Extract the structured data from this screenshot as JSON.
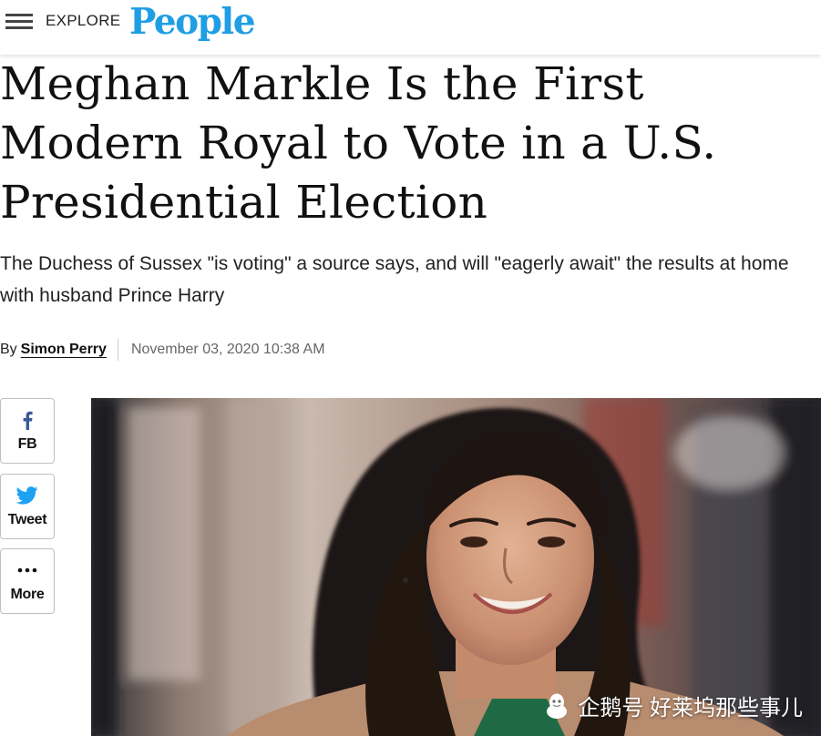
{
  "header": {
    "explore_label": "EXPLORE",
    "logo_text": "People"
  },
  "article": {
    "headline": "Meghan Markle Is the First Modern Royal to Vote in a U.S. Presidential Election",
    "dek": "The Duchess of Sussex \"is voting\" a source says, and will \"eagerly await\" the results at home with husband Prince Harry",
    "byline_prefix": "By",
    "author": "Simon Perry",
    "date": "November 03, 2020 10:38 AM"
  },
  "share": {
    "fb_label": "FB",
    "tweet_label": "Tweet",
    "more_label": "More"
  },
  "watermark": {
    "text": "企鹅号 好莱坞那些事儿"
  },
  "colors": {
    "brand_blue": "#1f9ee4",
    "facebook_blue": "#3b5998",
    "twitter_blue": "#1da1f2"
  }
}
